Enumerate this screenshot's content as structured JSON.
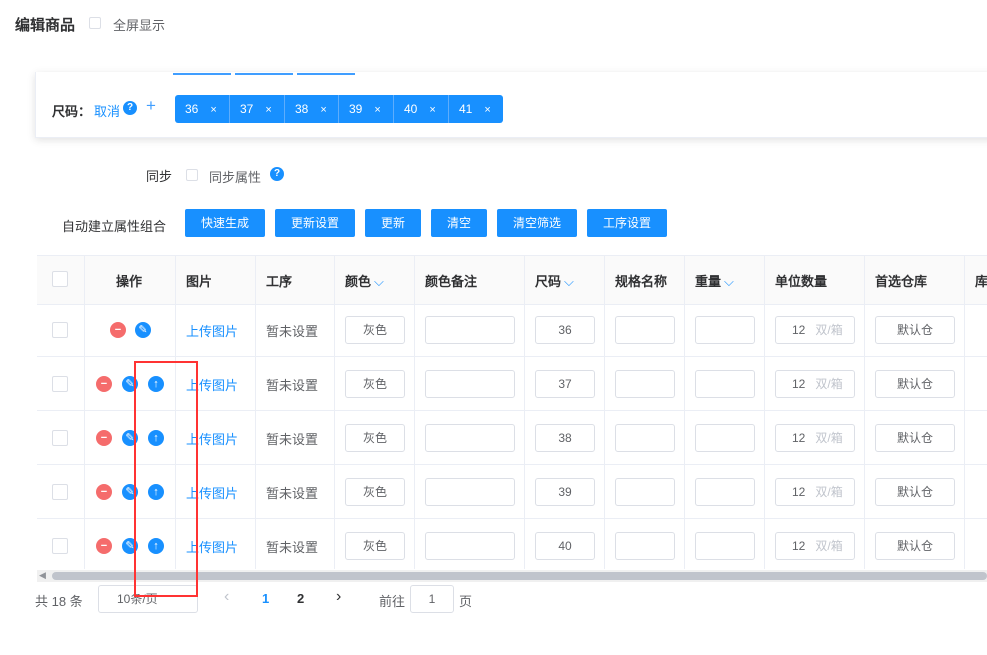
{
  "header": {
    "title": "编辑商品",
    "fullscreen_label": "全屏显示"
  },
  "size_attr": {
    "label": "尺码：",
    "cancel": "取消",
    "help": "?",
    "add": "+",
    "tags": [
      {
        "value": "36",
        "close": "×"
      },
      {
        "value": "37",
        "close": "×"
      },
      {
        "value": "38",
        "close": "×"
      },
      {
        "value": "39",
        "close": "×"
      },
      {
        "value": "40",
        "close": "×"
      },
      {
        "value": "41",
        "close": "×"
      }
    ]
  },
  "sync": {
    "label": "同步",
    "checkbox_label": "同步属性",
    "help": "?"
  },
  "auto_build": {
    "label": "自动建立属性组合",
    "buttons": [
      "快速生成",
      "更新设置",
      "更新",
      "清空",
      "清空筛选",
      "工序设置"
    ]
  },
  "table": {
    "columns": [
      "操作",
      "图片",
      "工序",
      "颜色",
      "颜色备注",
      "尺码",
      "规格名称",
      "重量",
      "单位数量",
      "首选仓库",
      "库"
    ],
    "sort_icon": "⌵",
    "rows": [
      {
        "image": "上传图片",
        "process": "暂未设置",
        "color": "灰色",
        "color_note": "",
        "size": "36",
        "spec": "",
        "weight": "",
        "unit_qty": "12",
        "unit": "双/箱",
        "warehouse": "默认仓"
      },
      {
        "image": "上传图片",
        "process": "暂未设置",
        "color": "灰色",
        "color_note": "",
        "size": "37",
        "spec": "",
        "weight": "",
        "unit_qty": "12",
        "unit": "双/箱",
        "warehouse": "默认仓"
      },
      {
        "image": "上传图片",
        "process": "暂未设置",
        "color": "灰色",
        "color_note": "",
        "size": "38",
        "spec": "",
        "weight": "",
        "unit_qty": "12",
        "unit": "双/箱",
        "warehouse": "默认仓"
      },
      {
        "image": "上传图片",
        "process": "暂未设置",
        "color": "灰色",
        "color_note": "",
        "size": "39",
        "spec": "",
        "weight": "",
        "unit_qty": "12",
        "unit": "双/箱",
        "warehouse": "默认仓"
      },
      {
        "image": "上传图片",
        "process": "暂未设置",
        "color": "灰色",
        "color_note": "",
        "size": "40",
        "spec": "",
        "weight": "",
        "unit_qty": "12",
        "unit": "双/箱",
        "warehouse": "默认仓"
      }
    ]
  },
  "pagination": {
    "total": "共 18 条",
    "page_size": "10条/页",
    "prev": "‹",
    "pages": [
      "1",
      "2"
    ],
    "next": "›",
    "goto_label": "前往",
    "goto_value": "1",
    "page_suffix": "页"
  },
  "icons": {
    "remove": "−",
    "edit": "✎",
    "up": "↑"
  },
  "colors": {
    "primary": "#1890ff",
    "danger": "#f56c6c",
    "highlight_box": "#ff3333"
  }
}
